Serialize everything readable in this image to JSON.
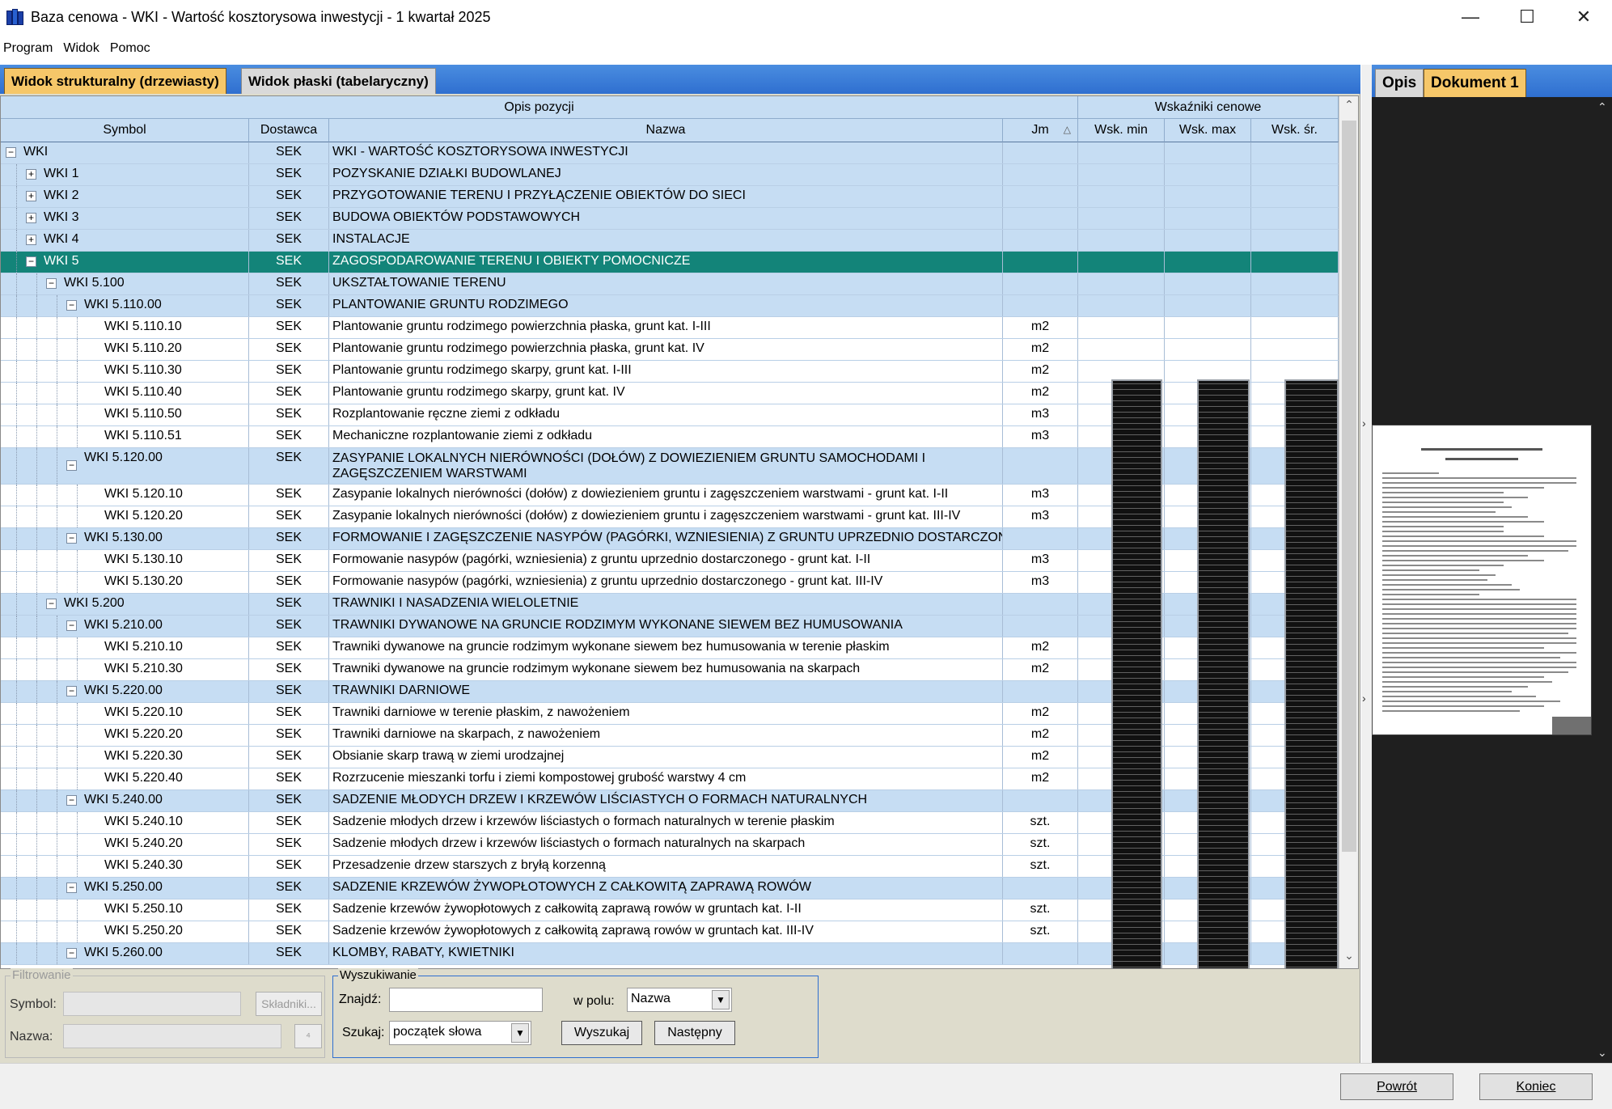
{
  "window": {
    "title": "Baza cenowa - WKI - Wartość kosztorysowa inwestycji - 1 kwartał 2025",
    "minimize": "—",
    "maximize": "☐",
    "close": "✕"
  },
  "menu": [
    "Program",
    "Widok",
    "Pomoc"
  ],
  "tabs": {
    "structural": "Widok strukturalny (drzewiasty)",
    "flat": "Widok płaski (tabelaryczny)"
  },
  "grid": {
    "group_opis": "Opis pozycji",
    "group_wsk": "Wskaźniki cenowe",
    "columns": {
      "symbol": "Symbol",
      "dostawca": "Dostawca",
      "nazwa": "Nazwa",
      "jm": "Jm",
      "wsk_min": "Wsk. min",
      "wsk_max": "Wsk. max",
      "wsk_sr": "Wsk. śr."
    },
    "rows": [
      {
        "level": 0,
        "exp": "−",
        "symbol": "WKI",
        "dostawca": "SEK",
        "nazwa": "WKI - WARTOŚĆ KOSZTORYSOWA INWESTYCJI",
        "jm": "",
        "type": "group"
      },
      {
        "level": 1,
        "exp": "+",
        "symbol": "WKI 1",
        "dostawca": "SEK",
        "nazwa": "POZYSKANIE DZIAŁKI BUDOWLANEJ",
        "jm": "",
        "type": "group"
      },
      {
        "level": 1,
        "exp": "+",
        "symbol": "WKI 2",
        "dostawca": "SEK",
        "nazwa": "PRZYGOTOWANIE TERENU I PRZYŁĄCZENIE OBIEKTÓW DO SIECI",
        "jm": "",
        "type": "group"
      },
      {
        "level": 1,
        "exp": "+",
        "symbol": "WKI 3",
        "dostawca": "SEK",
        "nazwa": "BUDOWA OBIEKTÓW PODSTAWOWYCH",
        "jm": "",
        "type": "group"
      },
      {
        "level": 1,
        "exp": "+",
        "symbol": "WKI 4",
        "dostawca": "SEK",
        "nazwa": "INSTALACJE",
        "jm": "",
        "type": "group"
      },
      {
        "level": 1,
        "exp": "−",
        "symbol": "WKI 5",
        "dostawca": "SEK",
        "nazwa": "ZAGOSPODAROWANIE TERENU I OBIEKTY POMOCNICZE",
        "jm": "",
        "type": "selected"
      },
      {
        "level": 2,
        "exp": "−",
        "symbol": "WKI 5.100",
        "dostawca": "SEK",
        "nazwa": "UKSZTAŁTOWANIE TERENU",
        "jm": "",
        "type": "group"
      },
      {
        "level": 3,
        "exp": "−",
        "symbol": "WKI 5.110.00",
        "dostawca": "SEK",
        "nazwa": "PLANTOWANIE GRUNTU RODZIMEGO",
        "jm": "",
        "type": "group"
      },
      {
        "level": 4,
        "exp": "",
        "symbol": "WKI 5.110.10",
        "dostawca": "SEK",
        "nazwa": "Plantowanie gruntu rodzimego powierzchnia płaska, grunt kat. I-III",
        "jm": "m2",
        "type": "leaf"
      },
      {
        "level": 4,
        "exp": "",
        "symbol": "WKI 5.110.20",
        "dostawca": "SEK",
        "nazwa": "Plantowanie gruntu rodzimego powierzchnia płaska, grunt kat. IV",
        "jm": "m2",
        "type": "leaf"
      },
      {
        "level": 4,
        "exp": "",
        "symbol": "WKI 5.110.30",
        "dostawca": "SEK",
        "nazwa": "Plantowanie gruntu rodzimego skarpy, grunt kat. I-III",
        "jm": "m2",
        "type": "leaf"
      },
      {
        "level": 4,
        "exp": "",
        "symbol": "WKI 5.110.40",
        "dostawca": "SEK",
        "nazwa": "Plantowanie gruntu rodzimego skarpy, grunt kat. IV",
        "jm": "m2",
        "type": "leaf"
      },
      {
        "level": 4,
        "exp": "",
        "symbol": "WKI 5.110.50",
        "dostawca": "SEK",
        "nazwa": "Rozplantowanie ręczne ziemi z odkładu",
        "jm": "m3",
        "type": "leaf"
      },
      {
        "level": 4,
        "exp": "",
        "symbol": "WKI 5.110.51",
        "dostawca": "SEK",
        "nazwa": "Mechaniczne rozplantowanie ziemi z odkładu",
        "jm": "m3",
        "type": "leaf"
      },
      {
        "level": 3,
        "exp": "−",
        "symbol": "WKI 5.120.00",
        "dostawca": "SEK",
        "nazwa": "ZASYPANIE LOKALNYCH NIERÓWNOŚCI (DOŁÓW) Z DOWIEZIENIEM GRUNTU SAMOCHODAMI I ZAGĘSZCZENIEM WARSTWAMI",
        "jm": "",
        "type": "group",
        "tall": true
      },
      {
        "level": 4,
        "exp": "",
        "symbol": "WKI 5.120.10",
        "dostawca": "SEK",
        "nazwa": "Zasypanie lokalnych nierówności (dołów) z dowiezieniem gruntu i zagęszczeniem warstwami - grunt kat. I-II",
        "jm": "m3",
        "type": "leaf"
      },
      {
        "level": 4,
        "exp": "",
        "symbol": "WKI 5.120.20",
        "dostawca": "SEK",
        "nazwa": "Zasypanie lokalnych nierówności (dołów) z dowiezieniem gruntu i zagęszczeniem warstwami - grunt kat. III-IV",
        "jm": "m3",
        "type": "leaf"
      },
      {
        "level": 3,
        "exp": "−",
        "symbol": "WKI 5.130.00",
        "dostawca": "SEK",
        "nazwa": "FORMOWANIE I ZAGĘSZCZENIE NASYPÓW (PAGÓRKI, WZNIESIENIA) Z GRUNTU UPRZEDNIO DOSTARCZONEGO",
        "jm": "",
        "type": "group"
      },
      {
        "level": 4,
        "exp": "",
        "symbol": "WKI 5.130.10",
        "dostawca": "SEK",
        "nazwa": "Formowanie nasypów (pagórki, wzniesienia) z gruntu uprzednio dostarczonego - grunt kat. I-II",
        "jm": "m3",
        "type": "leaf"
      },
      {
        "level": 4,
        "exp": "",
        "symbol": "WKI 5.130.20",
        "dostawca": "SEK",
        "nazwa": "Formowanie nasypów (pagórki, wzniesienia) z gruntu uprzednio dostarczonego - grunt kat. III-IV",
        "jm": "m3",
        "type": "leaf"
      },
      {
        "level": 2,
        "exp": "−",
        "symbol": "WKI 5.200",
        "dostawca": "SEK",
        "nazwa": "TRAWNIKI I NASADZENIA WIELOLETNIE",
        "jm": "",
        "type": "group"
      },
      {
        "level": 3,
        "exp": "−",
        "symbol": "WKI 5.210.00",
        "dostawca": "SEK",
        "nazwa": "TRAWNIKI DYWANOWE NA GRUNCIE RODZIMYM WYKONANE SIEWEM BEZ HUMUSOWANIA",
        "jm": "",
        "type": "group"
      },
      {
        "level": 4,
        "exp": "",
        "symbol": "WKI 5.210.10",
        "dostawca": "SEK",
        "nazwa": "Trawniki dywanowe na gruncie rodzimym wykonane siewem bez humusowania w terenie płaskim",
        "jm": "m2",
        "type": "leaf"
      },
      {
        "level": 4,
        "exp": "",
        "symbol": "WKI 5.210.30",
        "dostawca": "SEK",
        "nazwa": "Trawniki dywanowe na gruncie rodzimym wykonane siewem bez humusowania na skarpach",
        "jm": "m2",
        "type": "leaf"
      },
      {
        "level": 3,
        "exp": "−",
        "symbol": "WKI 5.220.00",
        "dostawca": "SEK",
        "nazwa": "TRAWNIKI DARNIOWE",
        "jm": "",
        "type": "group"
      },
      {
        "level": 4,
        "exp": "",
        "symbol": "WKI 5.220.10",
        "dostawca": "SEK",
        "nazwa": "Trawniki darniowe w terenie płaskim, z nawożeniem",
        "jm": "m2",
        "type": "leaf"
      },
      {
        "level": 4,
        "exp": "",
        "symbol": "WKI 5.220.20",
        "dostawca": "SEK",
        "nazwa": "Trawniki darniowe na skarpach, z nawożeniem",
        "jm": "m2",
        "type": "leaf"
      },
      {
        "level": 4,
        "exp": "",
        "symbol": "WKI 5.220.30",
        "dostawca": "SEK",
        "nazwa": "Obsianie skarp trawą w ziemi urodzajnej",
        "jm": "m2",
        "type": "leaf"
      },
      {
        "level": 4,
        "exp": "",
        "symbol": "WKI 5.220.40",
        "dostawca": "SEK",
        "nazwa": "Rozrzucenie mieszanki torfu i ziemi kompostowej grubość warstwy 4 cm",
        "jm": "m2",
        "type": "leaf"
      },
      {
        "level": 3,
        "exp": "−",
        "symbol": "WKI 5.240.00",
        "dostawca": "SEK",
        "nazwa": "SADZENIE MŁODYCH DRZEW I KRZEWÓW LIŚCIASTYCH O FORMACH NATURALNYCH",
        "jm": "",
        "type": "group"
      },
      {
        "level": 4,
        "exp": "",
        "symbol": "WKI 5.240.10",
        "dostawca": "SEK",
        "nazwa": "Sadzenie młodych drzew i krzewów liściastych o formach naturalnych w terenie płaskim",
        "jm": "szt.",
        "type": "leaf"
      },
      {
        "level": 4,
        "exp": "",
        "symbol": "WKI 5.240.20",
        "dostawca": "SEK",
        "nazwa": "Sadzenie młodych drzew i krzewów liściastych o formach naturalnych na skarpach",
        "jm": "szt.",
        "type": "leaf"
      },
      {
        "level": 4,
        "exp": "",
        "symbol": "WKI 5.240.30",
        "dostawca": "SEK",
        "nazwa": "Przesadzenie drzew starszych z bryłą korzenną",
        "jm": "szt.",
        "type": "leaf"
      },
      {
        "level": 3,
        "exp": "−",
        "symbol": "WKI 5.250.00",
        "dostawca": "SEK",
        "nazwa": "SADZENIE KRZEWÓW ŻYWOPŁOTOWYCH Z CAŁKOWITĄ ZAPRAWĄ ROWÓW",
        "jm": "",
        "type": "group"
      },
      {
        "level": 4,
        "exp": "",
        "symbol": "WKI 5.250.10",
        "dostawca": "SEK",
        "nazwa": "Sadzenie krzewów żywopłotowych z całkowitą zaprawą rowów w gruntach kat. I-II",
        "jm": "szt.",
        "type": "leaf"
      },
      {
        "level": 4,
        "exp": "",
        "symbol": "WKI 5.250.20",
        "dostawca": "SEK",
        "nazwa": "Sadzenie krzewów żywopłotowych z całkowitą zaprawą rowów w gruntach kat. III-IV",
        "jm": "szt.",
        "type": "leaf"
      },
      {
        "level": 3,
        "exp": "−",
        "symbol": "WKI 5.260.00",
        "dostawca": "SEK",
        "nazwa": "KLOMBY, RABATY, KWIETNIKI",
        "jm": "",
        "type": "group"
      }
    ]
  },
  "filter": {
    "legend": "Filtrowanie",
    "symbol_label": "Symbol:",
    "nazwa_label": "Nazwa:",
    "skladniki_button": "Składniki...",
    "apply_button": "⁴"
  },
  "search": {
    "legend": "Wyszukiwanie",
    "znajdz_label": "Znajdź:",
    "znajdz_value": "",
    "w_polu_label": "w polu:",
    "w_polu_value": "Nazwa",
    "szukaj_label": "Szukaj:",
    "szukaj_value": "początek słowa",
    "wyszukaj_button": "Wyszukaj",
    "nastepny_button": "Następny"
  },
  "right_panel": {
    "tab_opis": "Opis",
    "tab_dokument": "Dokument 1"
  },
  "footer": {
    "powrot_button": "Powrót",
    "koniec_button": "Koniec"
  }
}
